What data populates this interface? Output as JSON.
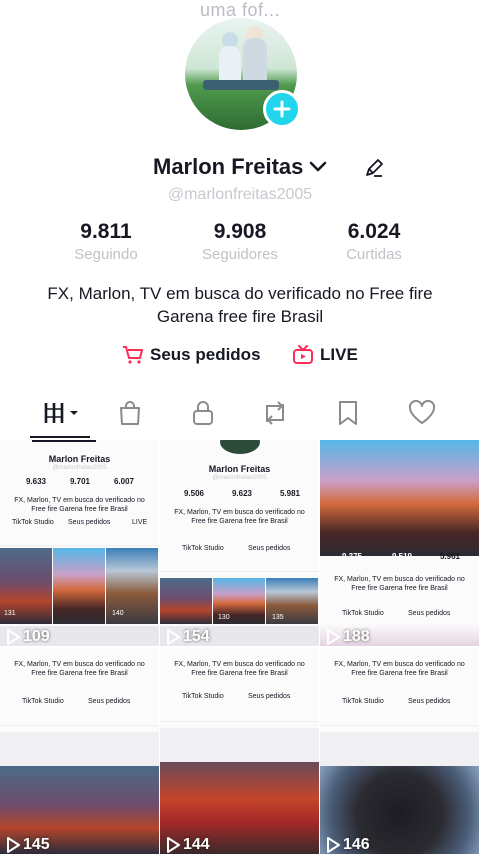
{
  "caption": "uma fof...",
  "profile": {
    "name": "Marlon Freitas",
    "handle": "@marlonfreitas2005",
    "bio": "FX, Marlon, TV em busca do verificado no Free fire Garena free fire Brasil"
  },
  "stats": [
    {
      "value": "9.811",
      "label": "Seguindo"
    },
    {
      "value": "9.908",
      "label": "Seguidores"
    },
    {
      "value": "6.024",
      "label": "Curtidas"
    }
  ],
  "actions": {
    "orders_label": "Seus pedidos",
    "live_label": "LIVE"
  },
  "tabs": [
    {
      "icon": "grid-icon"
    },
    {
      "icon": "bag-icon"
    },
    {
      "icon": "lock-icon"
    },
    {
      "icon": "repost-icon"
    },
    {
      "icon": "bookmark-icon"
    },
    {
      "icon": "heart-icon"
    }
  ],
  "videos": [
    {
      "views": "109",
      "mini": {
        "name": "Marlon Freitas",
        "handle": "@marlonfreitas2005",
        "stats": [
          "9.633",
          "9.701",
          "6.007"
        ],
        "bio": "FX, Marlon, TV em busca do verificado no Free fire Garena free fire Brasil",
        "studio": "TikTok Studio",
        "orders": "Seus pedidos",
        "live": "LIVE",
        "thumbs": [
          "131",
          "140"
        ]
      }
    },
    {
      "views": "154",
      "mini": {
        "name": "Marlon Freitas",
        "handle": "@marlonfreitas2005",
        "stats": [
          "9.506",
          "9.623",
          "5.981"
        ],
        "bio": "FX, Marlon, TV em busca do verificado no Free fire Garena free fire Brasil",
        "studio": "TikTok Studio",
        "orders": "Seus pedidos",
        "thumbs": [
          "130",
          "135"
        ]
      }
    },
    {
      "views": "188",
      "mini": {
        "stats": [
          "9.375",
          "9.519",
          "5.961"
        ],
        "bio": "FX, Marlon, TV em busca do verificado no Free fire Garena free fire Brasil",
        "studio": "TikTok Studio",
        "orders": "Seus pedidos"
      }
    },
    {
      "views": "145",
      "mini": {
        "bio": "FX, Marlon, TV em busca do verificado no Free fire Garena free fire Brasil",
        "studio": "TikTok Studio",
        "orders": "Seus pedidos"
      }
    },
    {
      "views": "144",
      "mini": {
        "bio": "FX, Marlon, TV em busca do verificado no Free fire Garena free fire Brasil",
        "studio": "TikTok Studio",
        "orders": "Seus pedidos"
      }
    },
    {
      "views": "146",
      "mini": {
        "bio": "FX, Marlon, TV em busca do verificado no Free fire Garena free fire Brasil",
        "studio": "TikTok Studio",
        "orders": "Seus pedidos"
      }
    }
  ],
  "colors": {
    "accent": "#20d5ec",
    "pink": "#fe2c55",
    "text": "#161823",
    "muted": "#c0c2c8"
  }
}
